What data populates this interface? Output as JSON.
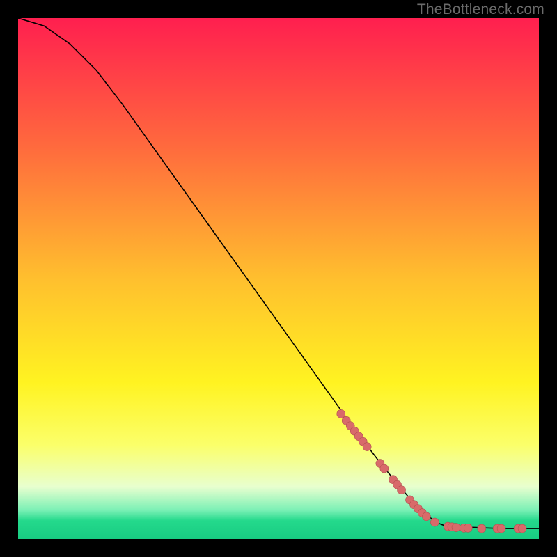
{
  "watermark": "TheBottleneck.com",
  "chart_data": {
    "type": "line",
    "title": "",
    "xlabel": "",
    "ylabel": "",
    "xlim": [
      0,
      100
    ],
    "ylim": [
      0,
      100
    ],
    "grid": false,
    "legend": false,
    "gradient_stops": [
      {
        "offset": 0.0,
        "color": "#ff1f4f"
      },
      {
        "offset": 0.25,
        "color": "#ff6b3d"
      },
      {
        "offset": 0.5,
        "color": "#ffbf2e"
      },
      {
        "offset": 0.7,
        "color": "#fff321"
      },
      {
        "offset": 0.82,
        "color": "#fbff6a"
      },
      {
        "offset": 0.9,
        "color": "#e8ffcf"
      },
      {
        "offset": 0.945,
        "color": "#7af0b5"
      },
      {
        "offset": 0.965,
        "color": "#24d98c"
      },
      {
        "offset": 1.0,
        "color": "#18cc82"
      }
    ],
    "series": [
      {
        "name": "curve",
        "x": [
          0,
          5,
          10,
          15,
          20,
          25,
          30,
          35,
          40,
          45,
          50,
          55,
          60,
          65,
          70,
          75,
          80,
          82,
          85,
          88,
          90,
          93,
          96,
          100
        ],
        "y": [
          100,
          98.5,
          95,
          90,
          83.5,
          76.5,
          69.5,
          62.5,
          55.5,
          48.5,
          41.5,
          34.5,
          27.5,
          20.5,
          14,
          8,
          3.3,
          2.5,
          2.3,
          2.2,
          2.1,
          2.0,
          2.0,
          2.0
        ]
      }
    ],
    "markers": [
      {
        "x": 62.0,
        "y": 24.0
      },
      {
        "x": 63.0,
        "y": 22.7
      },
      {
        "x": 63.8,
        "y": 21.7
      },
      {
        "x": 64.6,
        "y": 20.7
      },
      {
        "x": 65.4,
        "y": 19.7
      },
      {
        "x": 66.2,
        "y": 18.7
      },
      {
        "x": 67.0,
        "y": 17.7
      },
      {
        "x": 69.5,
        "y": 14.5
      },
      {
        "x": 70.3,
        "y": 13.5
      },
      {
        "x": 72.0,
        "y": 11.4
      },
      {
        "x": 72.8,
        "y": 10.4
      },
      {
        "x": 73.6,
        "y": 9.4
      },
      {
        "x": 75.2,
        "y": 7.5
      },
      {
        "x": 76.0,
        "y": 6.6
      },
      {
        "x": 76.8,
        "y": 5.8
      },
      {
        "x": 77.6,
        "y": 5.0
      },
      {
        "x": 78.4,
        "y": 4.3
      },
      {
        "x": 80.0,
        "y": 3.2
      },
      {
        "x": 82.5,
        "y": 2.4
      },
      {
        "x": 83.3,
        "y": 2.3
      },
      {
        "x": 84.1,
        "y": 2.2
      },
      {
        "x": 85.6,
        "y": 2.1
      },
      {
        "x": 86.4,
        "y": 2.1
      },
      {
        "x": 89.0,
        "y": 2.0
      },
      {
        "x": 92.0,
        "y": 2.0
      },
      {
        "x": 92.8,
        "y": 2.0
      },
      {
        "x": 96.0,
        "y": 2.0
      },
      {
        "x": 96.8,
        "y": 2.0
      }
    ],
    "marker_radius": 6
  }
}
